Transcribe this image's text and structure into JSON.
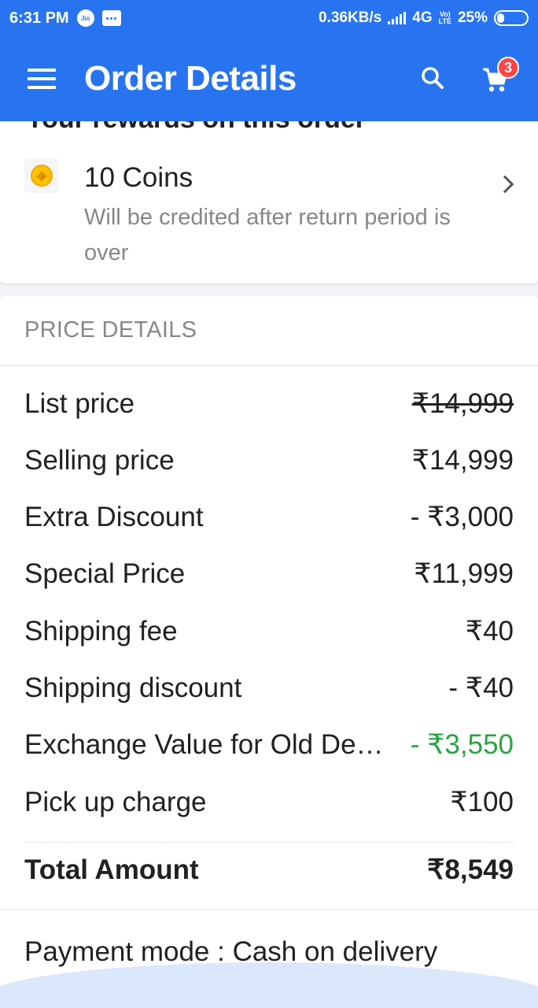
{
  "status_bar": {
    "time": "6:31 PM",
    "carrier_icon": "Jio",
    "network_speed": "0.36KB/s",
    "network_type": "4G",
    "volte": "Vo) LTE",
    "battery": "25%"
  },
  "app_bar": {
    "title": "Order Details",
    "cart_count": "3",
    "icons": [
      "menu-icon",
      "search-icon",
      "cart-icon"
    ]
  },
  "rewards": {
    "heading_partial": "Your rewards on this order",
    "coins_title": "10 Coins",
    "coins_subtitle": "Will be credited after return period is over",
    "icon": "coin-icon"
  },
  "price_details": {
    "header": "PRICE DETAILS",
    "rows": [
      {
        "label": "List price",
        "value": "₹14,999"
      },
      {
        "label": "Selling price",
        "value": "₹14,999"
      },
      {
        "label": "Extra Discount",
        "value": "- ₹3,000"
      },
      {
        "label": "Special Price",
        "value": "₹11,999"
      },
      {
        "label": "Shipping fee",
        "value": "₹40"
      },
      {
        "label": "Shipping discount",
        "value": "- ₹40"
      },
      {
        "label": "Exchange Value for Old Device",
        "value": "- ₹3,550"
      },
      {
        "label": "Pick up charge",
        "value": "₹100"
      }
    ],
    "total_label": "Total Amount",
    "total_value": "₹8,549",
    "payment_mode": "Payment mode : Cash on delivery"
  },
  "colors": {
    "brand_blue": "#2874f0",
    "green": "#26a541",
    "badge_red": "#ff4343"
  }
}
